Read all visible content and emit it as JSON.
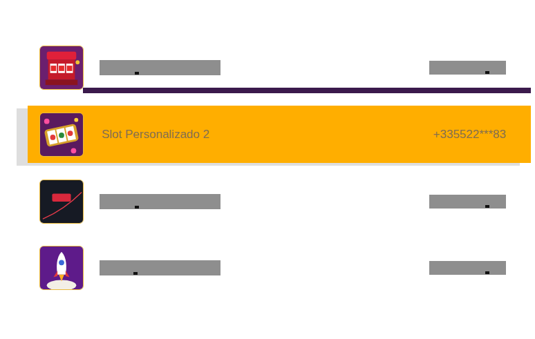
{
  "rows": [
    {
      "redacted": true,
      "selected": false,
      "divider": true
    },
    {
      "name": "Slot Personalizado 2",
      "phone": "+335522***83",
      "redacted": false,
      "selected": true,
      "divider": false
    },
    {
      "redacted": true,
      "selected": false,
      "divider": false
    },
    {
      "redacted": true,
      "selected": false,
      "divider": false
    }
  ]
}
